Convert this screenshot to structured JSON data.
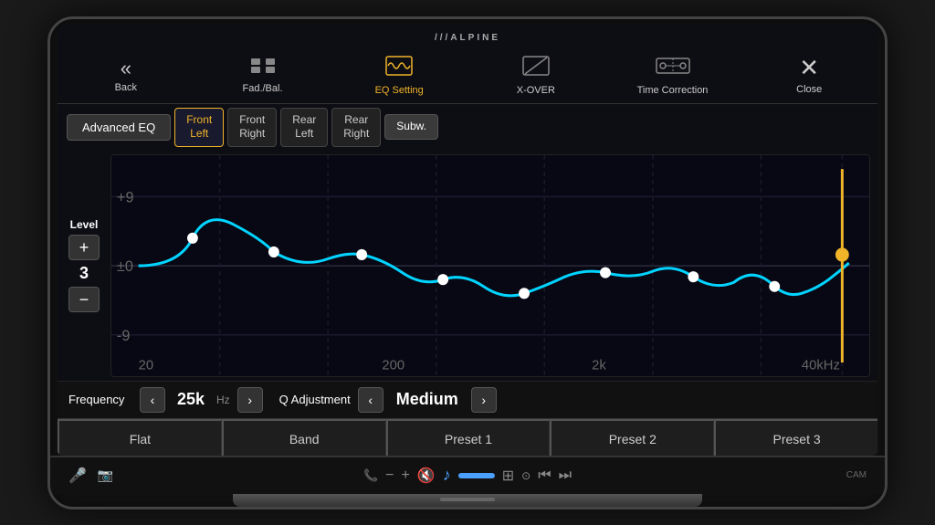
{
  "brand": "///ALPINE",
  "nav": {
    "items": [
      {
        "id": "back",
        "label": "Back",
        "icon": "«"
      },
      {
        "id": "fad-bal",
        "label": "Fad./Bal.",
        "icon": "⊞"
      },
      {
        "id": "eq-setting",
        "label": "EQ Setting",
        "icon": "〰",
        "active": true
      },
      {
        "id": "x-over",
        "label": "X-OVER",
        "icon": "╱"
      },
      {
        "id": "time-correction",
        "label": "Time Correction",
        "icon": "⊡"
      },
      {
        "id": "close",
        "label": "Close",
        "icon": "✕"
      }
    ]
  },
  "speaker_tabs": {
    "advanced_eq": "Advanced EQ",
    "tabs": [
      {
        "id": "front-left",
        "label": "Front\nLeft",
        "active": true
      },
      {
        "id": "front-right",
        "label": "Front\nRight"
      },
      {
        "id": "rear-left",
        "label": "Rear\nLeft"
      },
      {
        "id": "rear-right",
        "label": "Rear\nRight"
      },
      {
        "id": "subwoofer",
        "label": "Subw.",
        "special": true
      }
    ]
  },
  "eq": {
    "level_label": "Level",
    "level_value": "3",
    "plus_label": "+",
    "minus_label": "−",
    "graph": {
      "y_top": "+9",
      "y_mid": "±0",
      "y_bot": "-9",
      "x_labels": [
        "20",
        "200",
        "2k",
        "40kHz"
      ]
    }
  },
  "frequency": {
    "label": "Frequency",
    "value": "25k",
    "unit": "Hz",
    "left_arrow": "‹",
    "right_arrow": "›"
  },
  "q_adjustment": {
    "label": "Q Adjustment",
    "value": "Medium",
    "left_arrow": "‹",
    "right_arrow": "›"
  },
  "presets": [
    {
      "id": "flat",
      "label": "Flat"
    },
    {
      "id": "band",
      "label": "Band"
    },
    {
      "id": "preset1",
      "label": "Preset 1"
    },
    {
      "id": "preset2",
      "label": "Preset 2"
    },
    {
      "id": "preset3",
      "label": "Preset 3"
    }
  ],
  "bottom_bar": {
    "icons_left": [
      "🎤",
      "📷"
    ],
    "icons_center": [
      "📞",
      "−",
      "+",
      "🔇",
      "♪",
      "▮▮",
      "⊞",
      "⊙",
      "⏮",
      "⏭"
    ],
    "icons_right": [
      "CAM"
    ]
  }
}
